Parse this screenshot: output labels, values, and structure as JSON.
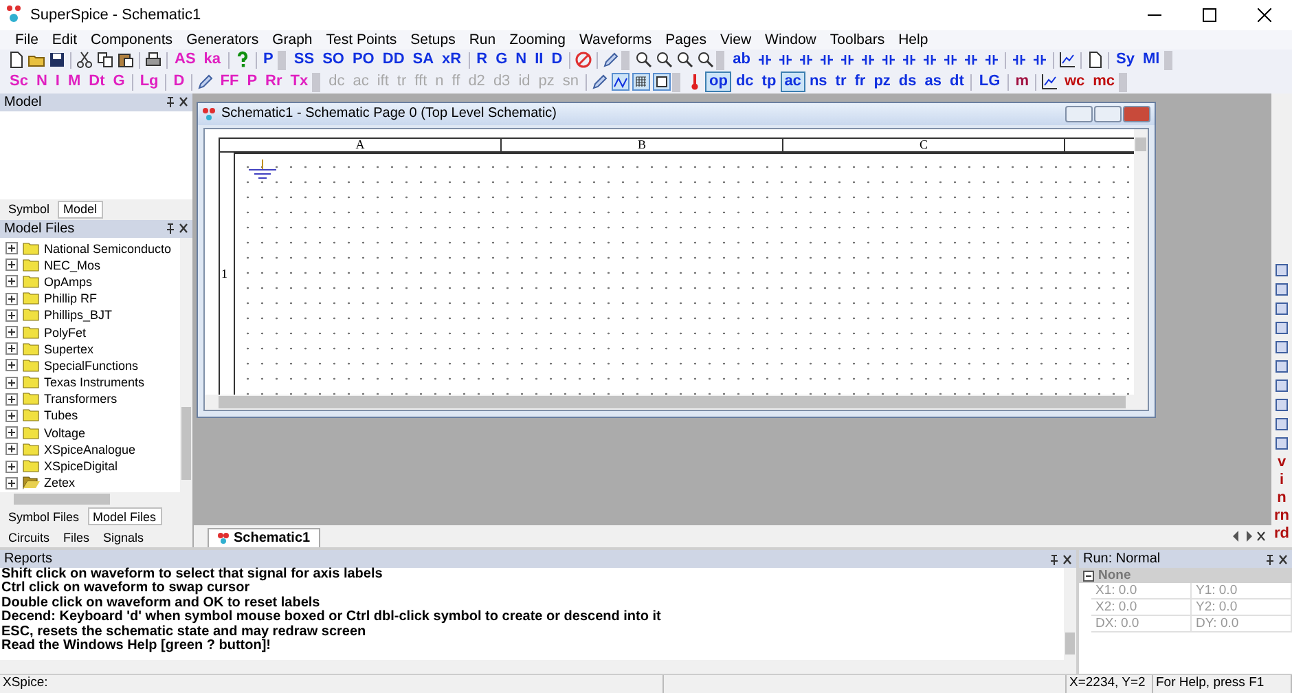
{
  "window": {
    "title": "SuperSpice - Schematic1"
  },
  "menu": [
    "File",
    "Edit",
    "Components",
    "Generators",
    "Graph",
    "Test Points",
    "Setups",
    "Run",
    "Zooming",
    "Waveforms",
    "Pages",
    "View",
    "Window",
    "Toolbars",
    "Help"
  ],
  "toolbars": [
    {
      "items": [
        {
          "kind": "doc"
        },
        {
          "kind": "folder"
        },
        {
          "kind": "disk"
        },
        {
          "kind": "sep"
        },
        {
          "kind": "scissors"
        },
        {
          "kind": "copy"
        },
        {
          "kind": "paste"
        },
        {
          "kind": "sep"
        },
        {
          "kind": "printer"
        },
        {
          "kind": "sep"
        },
        {
          "kind": "text",
          "label": "AS",
          "color": "#e020c0",
          "selected": false,
          "disabled": false
        },
        {
          "kind": "text",
          "label": "ka",
          "color": "#e020c0",
          "selected": false,
          "disabled": false
        },
        {
          "kind": "sep"
        },
        {
          "kind": "help"
        },
        {
          "kind": "sep"
        },
        {
          "kind": "text",
          "label": "P",
          "color": "#1030e0",
          "selected": false,
          "disabled": false
        },
        {
          "kind": "drop"
        },
        {
          "kind": "text",
          "label": "SS",
          "color": "#1030e0",
          "selected": false,
          "disabled": false
        },
        {
          "kind": "text",
          "label": "SO",
          "color": "#1030e0",
          "selected": false,
          "disabled": false
        },
        {
          "kind": "text",
          "label": "PO",
          "color": "#1030e0",
          "selected": false,
          "disabled": false
        },
        {
          "kind": "text",
          "label": "DD",
          "color": "#1030e0",
          "selected": false,
          "disabled": false
        },
        {
          "kind": "text",
          "label": "SA",
          "color": "#1030e0",
          "selected": false,
          "disabled": false
        },
        {
          "kind": "text",
          "label": "xR",
          "color": "#1030e0",
          "selected": false,
          "disabled": false
        },
        {
          "kind": "sep"
        },
        {
          "kind": "text",
          "label": "R",
          "color": "#1030e0",
          "selected": false,
          "disabled": false
        },
        {
          "kind": "text",
          "label": "G",
          "color": "#1030e0",
          "selected": false,
          "disabled": false
        },
        {
          "kind": "text",
          "label": "N",
          "color": "#1030e0",
          "selected": false,
          "disabled": false
        },
        {
          "kind": "text",
          "label": "II",
          "color": "#1030e0",
          "selected": false,
          "disabled": false
        },
        {
          "kind": "text",
          "label": "D",
          "color": "#1030e0",
          "selected": false,
          "disabled": false
        },
        {
          "kind": "sep"
        },
        {
          "kind": "stop"
        },
        {
          "kind": "sep"
        },
        {
          "kind": "pencil"
        },
        {
          "kind": "drop"
        },
        {
          "kind": "zoom"
        },
        {
          "kind": "zoom"
        },
        {
          "kind": "zoom"
        },
        {
          "kind": "zoom"
        },
        {
          "kind": "drop"
        },
        {
          "kind": "text",
          "label": "ab",
          "color": "#1030e0",
          "selected": false,
          "disabled": false
        },
        {
          "kind": "glyph"
        },
        {
          "kind": "glyph"
        },
        {
          "kind": "glyph"
        },
        {
          "kind": "glyph"
        },
        {
          "kind": "glyph"
        },
        {
          "kind": "glyph"
        },
        {
          "kind": "glyph"
        },
        {
          "kind": "glyph"
        },
        {
          "kind": "glyph"
        },
        {
          "kind": "glyph"
        },
        {
          "kind": "glyph"
        },
        {
          "kind": "glyph"
        },
        {
          "kind": "sep"
        },
        {
          "kind": "glyph"
        },
        {
          "kind": "glyph"
        },
        {
          "kind": "sep"
        },
        {
          "kind": "chart"
        },
        {
          "kind": "sep"
        },
        {
          "kind": "doc"
        },
        {
          "kind": "sep"
        },
        {
          "kind": "text",
          "label": "Sy",
          "color": "#1030e0",
          "selected": false,
          "disabled": false
        },
        {
          "kind": "text",
          "label": "Ml",
          "color": "#1030e0",
          "selected": false,
          "disabled": false
        },
        {
          "kind": "drop"
        }
      ]
    },
    {
      "items": [
        {
          "kind": "text",
          "label": "Sc",
          "color": "#e020c0",
          "selected": false,
          "disabled": false
        },
        {
          "kind": "text",
          "label": "N",
          "color": "#e020c0",
          "selected": false,
          "disabled": false
        },
        {
          "kind": "text",
          "label": "I",
          "color": "#e020c0",
          "selected": false,
          "disabled": false
        },
        {
          "kind": "text",
          "label": "M",
          "color": "#e020c0",
          "selected": false,
          "disabled": false
        },
        {
          "kind": "text",
          "label": "Dt",
          "color": "#e020c0",
          "selected": false,
          "disabled": false
        },
        {
          "kind": "text",
          "label": "G",
          "color": "#e020c0",
          "selected": false,
          "disabled": false
        },
        {
          "kind": "sep"
        },
        {
          "kind": "text",
          "label": "Lg",
          "color": "#e020c0",
          "selected": false,
          "disabled": false
        },
        {
          "kind": "sep"
        },
        {
          "kind": "text",
          "label": "D",
          "color": "#e020c0",
          "selected": false,
          "disabled": false
        },
        {
          "kind": "sep"
        },
        {
          "kind": "pencil"
        },
        {
          "kind": "text",
          "label": "FF",
          "color": "#e020c0",
          "selected": false,
          "disabled": false
        },
        {
          "kind": "text",
          "label": "P",
          "color": "#e020c0",
          "selected": false,
          "disabled": false
        },
        {
          "kind": "text",
          "label": "Rr",
          "color": "#e020c0",
          "selected": false,
          "disabled": false
        },
        {
          "kind": "text",
          "label": "Tx",
          "color": "#e020c0",
          "selected": false,
          "disabled": false
        },
        {
          "kind": "drop"
        },
        {
          "kind": "text",
          "label": "dc",
          "selected": false,
          "disabled": true
        },
        {
          "kind": "text",
          "label": "ac",
          "selected": false,
          "disabled": true
        },
        {
          "kind": "text",
          "label": "ift",
          "selected": false,
          "disabled": true
        },
        {
          "kind": "text",
          "label": "tr",
          "selected": false,
          "disabled": true
        },
        {
          "kind": "text",
          "label": "fft",
          "selected": false,
          "disabled": true
        },
        {
          "kind": "text",
          "label": "n",
          "selected": false,
          "disabled": true
        },
        {
          "kind": "text",
          "label": "ff",
          "selected": false,
          "disabled": true
        },
        {
          "kind": "text",
          "label": "d2",
          "selected": false,
          "disabled": true
        },
        {
          "kind": "text",
          "label": "d3",
          "selected": false,
          "disabled": true
        },
        {
          "kind": "text",
          "label": "id",
          "selected": false,
          "disabled": true
        },
        {
          "kind": "text",
          "label": "pz",
          "selected": false,
          "disabled": true
        },
        {
          "kind": "text",
          "label": "sn",
          "selected": false,
          "disabled": true
        },
        {
          "kind": "sep"
        },
        {
          "kind": "pencil"
        },
        {
          "kind": "wave"
        },
        {
          "kind": "grid"
        },
        {
          "kind": "frame"
        },
        {
          "kind": "drop"
        },
        {
          "kind": "thermo"
        },
        {
          "kind": "text",
          "label": "op",
          "color": "#1030e0",
          "selected": true,
          "disabled": false
        },
        {
          "kind": "text",
          "label": "dc",
          "color": "#1030e0",
          "selected": false,
          "disabled": false
        },
        {
          "kind": "text",
          "label": "tp",
          "color": "#1030e0",
          "selected": false,
          "disabled": false
        },
        {
          "kind": "text",
          "label": "ac",
          "color": "#1030e0",
          "selected": true,
          "disabled": false
        },
        {
          "kind": "text",
          "label": "ns",
          "color": "#1030e0",
          "selected": false,
          "disabled": false
        },
        {
          "kind": "text",
          "label": "tr",
          "color": "#1030e0",
          "selected": false,
          "disabled": false
        },
        {
          "kind": "text",
          "label": "fr",
          "color": "#1030e0",
          "selected": false,
          "disabled": false
        },
        {
          "kind": "text",
          "label": "pz",
          "color": "#1030e0",
          "selected": false,
          "disabled": false
        },
        {
          "kind": "text",
          "label": "ds",
          "color": "#1030e0",
          "selected": false,
          "disabled": false
        },
        {
          "kind": "text",
          "label": "as",
          "color": "#1030e0",
          "selected": false,
          "disabled": false
        },
        {
          "kind": "text",
          "label": "dt",
          "color": "#1030e0",
          "selected": false,
          "disabled": false
        },
        {
          "kind": "sep"
        },
        {
          "kind": "text",
          "label": "LG",
          "color": "#1030e0",
          "selected": false,
          "disabled": false
        },
        {
          "kind": "sep"
        },
        {
          "kind": "text",
          "label": "m",
          "color": "#a01040",
          "selected": false,
          "disabled": false
        },
        {
          "kind": "sep"
        },
        {
          "kind": "chart"
        },
        {
          "kind": "text",
          "label": "wc",
          "color": "#c01010",
          "selected": false,
          "disabled": false
        },
        {
          "kind": "text",
          "label": "mc",
          "color": "#c01010",
          "selected": false,
          "disabled": false
        },
        {
          "kind": "drop"
        }
      ]
    }
  ],
  "model_panel": {
    "title": "Model",
    "tabs": [
      {
        "label": "Symbol",
        "selected": false
      },
      {
        "label": "Model",
        "selected": true
      }
    ]
  },
  "model_files": {
    "title": "Model Files",
    "items": [
      {
        "label": "National Semiconducto",
        "kind": "closed"
      },
      {
        "label": "NEC_Mos",
        "kind": "closed"
      },
      {
        "label": "OpAmps",
        "kind": "closed"
      },
      {
        "label": "Phillip RF",
        "kind": "closed"
      },
      {
        "label": "Phillips_BJT",
        "kind": "closed"
      },
      {
        "label": "PolyFet",
        "kind": "closed"
      },
      {
        "label": "Supertex",
        "kind": "closed"
      },
      {
        "label": "SpecialFunctions",
        "kind": "closed"
      },
      {
        "label": "Texas Instruments",
        "kind": "closed"
      },
      {
        "label": "Transformers",
        "kind": "closed"
      },
      {
        "label": "Tubes",
        "kind": "closed"
      },
      {
        "label": "Voltage",
        "kind": "closed"
      },
      {
        "label": "XSpiceAnalogue",
        "kind": "closed"
      },
      {
        "label": "XSpiceDigital",
        "kind": "closed"
      },
      {
        "label": "Zetex",
        "kind": "open"
      }
    ],
    "tabs": [
      {
        "label": "Symbol Files",
        "selected": false
      },
      {
        "label": "Model Files",
        "selected": true
      }
    ],
    "bottom_tabs": [
      {
        "label": "Circuits",
        "selected": false
      },
      {
        "label": "Files",
        "selected": false
      },
      {
        "label": "Signals",
        "selected": false
      }
    ]
  },
  "schematic_window": {
    "title": "Schematic1 -  Schematic Page 0 (Top Level Schematic)",
    "columns": [
      "A",
      "B",
      "C"
    ],
    "rows": [
      "1"
    ]
  },
  "document_tabs": [
    {
      "label": "Schematic1",
      "selected": true
    }
  ],
  "right_toolbar": [
    {
      "kind": "icon"
    },
    {
      "kind": "icon"
    },
    {
      "kind": "icon"
    },
    {
      "kind": "icon"
    },
    {
      "kind": "icon"
    },
    {
      "kind": "icon"
    },
    {
      "kind": "icon"
    },
    {
      "kind": "icon"
    },
    {
      "kind": "icon"
    },
    {
      "kind": "icon"
    },
    {
      "kind": "text",
      "label": "v"
    },
    {
      "kind": "text",
      "label": "i"
    },
    {
      "kind": "text",
      "label": "n"
    },
    {
      "kind": "text",
      "label": "rn"
    },
    {
      "kind": "text",
      "label": "rd"
    }
  ],
  "reports": {
    "title": "Reports",
    "lines": [
      "Shift click on waveform to select that signal for axis labels",
      "Ctrl click on waveform to swap cursor",
      "Double click on waveform and OK to reset labels",
      "Decend: Keyboard 'd' when symbol mouse boxed or Ctrl dbl-click symbol to create or descend into it",
      "ESC, resets the schematic state and may redraw screen",
      "Read the Windows Help [green ? button]!"
    ]
  },
  "run_panel": {
    "title": "Run: Normal",
    "node": {
      "label": "None",
      "expanded": true
    },
    "rows": [
      [
        "X1: 0.0",
        "Y1: 0.0"
      ],
      [
        "X2: 0.0",
        "Y2: 0.0"
      ],
      [
        "DX: 0.0",
        "DY: 0.0"
      ]
    ]
  },
  "status_bar": {
    "left": "XSpice:",
    "coords": "X=2234, Y=2",
    "help": "For Help, press F1"
  }
}
